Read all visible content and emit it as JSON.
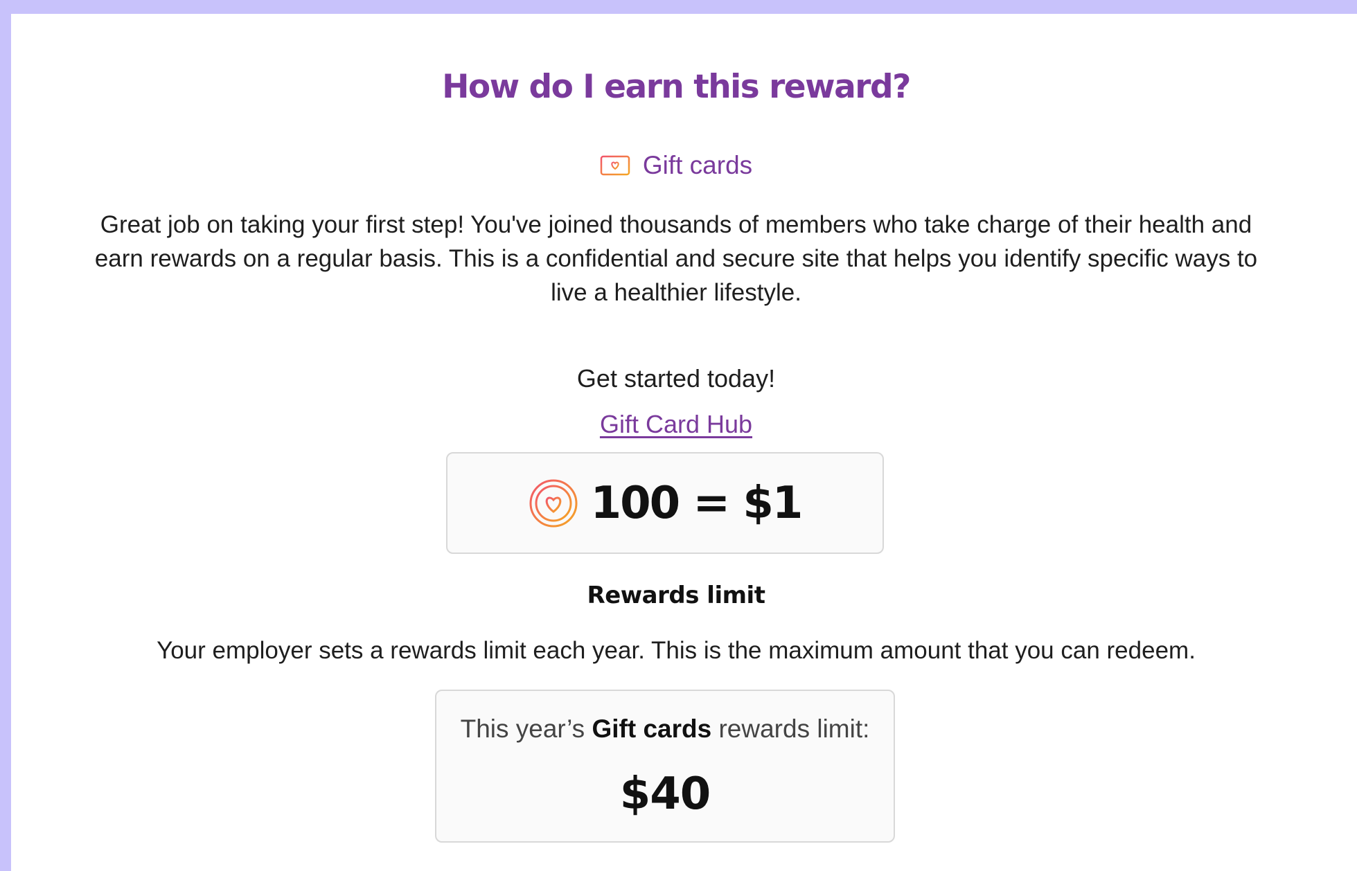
{
  "header": {
    "title": "How do I earn this reward?"
  },
  "reward_type": {
    "icon": "gift-card-icon",
    "label": "Gift cards"
  },
  "intro_text": "Great job on taking your first step! You've joined thousands of members who take charge of their health and earn rewards on a regular basis. This is a confidential and secure site that helps you identify specific ways to live a healthier lifestyle.",
  "get_started": {
    "text": "Get started today!",
    "link_label": "Gift Card Hub"
  },
  "conversion": {
    "icon": "heart-coin-icon",
    "text": "100 = $1"
  },
  "rewards_limit": {
    "heading": "Rewards limit",
    "description": "Your employer sets a rewards limit each year. This is the maximum amount that you can redeem.",
    "box_prefix": "This year’s ",
    "box_reward_name": "Gift cards",
    "box_suffix": " rewards limit:",
    "amount": "$40"
  },
  "colors": {
    "background": "#c8c2fb",
    "accent_purple": "#7a3a9c",
    "icon_gradient_start": "#f2556b",
    "icon_gradient_end": "#f5a623"
  }
}
